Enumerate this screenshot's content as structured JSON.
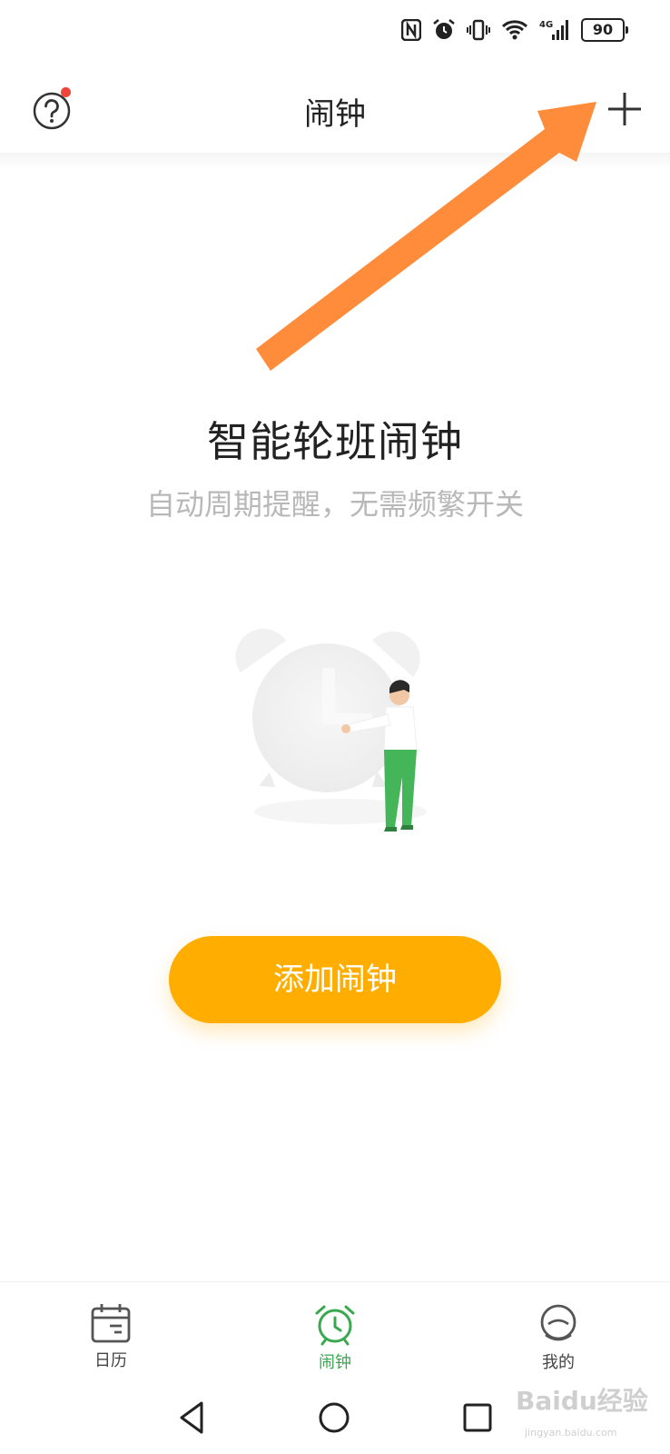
{
  "status_bar": {
    "battery": "90",
    "network": "4G",
    "icons": [
      "nfc-icon",
      "alarm-status-icon",
      "vibrate-icon",
      "wifi-icon",
      "signal-icon",
      "battery-icon"
    ]
  },
  "header": {
    "title": "闹钟",
    "help_icon": "question-circle-icon",
    "add_icon": "plus-icon"
  },
  "empty_state": {
    "title": "智能轮班闹钟",
    "subtitle": "自动周期提醒，无需频繁开关",
    "illustration": "alarm-clock-person-illustration"
  },
  "add_button_label": "添加闹钟",
  "bottom_nav": {
    "items": [
      {
        "label": "日历",
        "icon": "calendar-icon",
        "active": false
      },
      {
        "label": "闹钟",
        "icon": "alarm-clock-icon",
        "active": true
      },
      {
        "label": "我的",
        "icon": "profile-icon",
        "active": false
      }
    ]
  },
  "system_nav": [
    "back-icon",
    "home-icon",
    "recents-icon"
  ],
  "watermark": {
    "brand": "Baidu经验",
    "url": "jingyan.baidu.com"
  },
  "colors": {
    "accent": "#ffad00",
    "active_nav": "#3aa84f",
    "notification_dot": "#f04438",
    "arrow": "#ff8c3a",
    "subtitle": "#b8b8b8"
  }
}
